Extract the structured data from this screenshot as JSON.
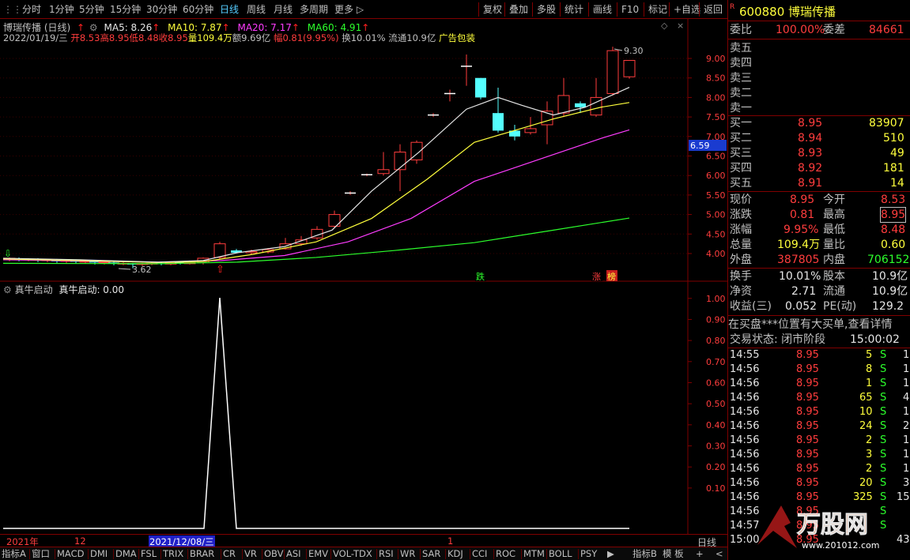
{
  "toolbar": {
    "left_items": [
      "分时",
      "1分钟",
      "5分钟",
      "15分钟",
      "30分钟",
      "60分钟",
      "日线",
      "周线",
      "月线",
      "多周期",
      "更多"
    ],
    "active": "日线",
    "right_items": [
      "复权",
      "叠加",
      "多股",
      "统计",
      "画线",
      "F10",
      "标记",
      "+自选",
      "返回"
    ]
  },
  "chart_header": {
    "title": "博瑞传播 (日线)",
    "ma5": "MA5: 8.26",
    "ma10": "MA10: 7.87",
    "ma20": "MA20: 7.17",
    "ma60": "MA60: 4.91",
    "info_date": "2022/01/19/三",
    "info_open": "开8.53",
    "info_high": "高8.95",
    "info_low": "低8.48",
    "info_close": "收8.95",
    "info_vol": "量109.4万",
    "info_amt": "额9.69亿",
    "info_chg": "幅0.81(9.95%)",
    "info_turn": "换10.01%",
    "info_float": "流通10.9亿",
    "info_tag": "广告包装"
  },
  "price_axis": [
    "9.00",
    "8.50",
    "8.00",
    "7.50",
    "7.00",
    "6.50",
    "6.00",
    "5.50",
    "5.00",
    "4.50",
    "4.00"
  ],
  "price_marker": "6.59",
  "annotations": {
    "high_label": "9.30",
    "low_label": "3.62",
    "tag_die": "跌",
    "tag_zhang": "涨",
    "tag_bang": "榜"
  },
  "indicator_header": {
    "name": "真牛启动",
    "value": "真牛启动: 0.00"
  },
  "indicator_axis": [
    "1.00",
    "0.90",
    "0.80",
    "0.70",
    "0.60",
    "0.50",
    "0.40",
    "0.30",
    "0.20",
    "0.10"
  ],
  "time_axis": {
    "y2021": "2021年",
    "m12": "12",
    "cursor_date": "2021/12/08/三",
    "m1": "1",
    "period": "日线"
  },
  "bottom_tabs": [
    "指标A",
    "窗口",
    "MACD",
    "DMI",
    "DMA",
    "FSL",
    "TRIX",
    "BRAR",
    "CR",
    "VR",
    "OBV",
    "ASI",
    "EMV",
    "VOL-TDX",
    "RSI",
    "WR",
    "SAR",
    "KDJ",
    "CCI",
    "ROC",
    "MTM",
    "BOLL",
    "PSY"
  ],
  "bottom_right": [
    "指标B",
    "模 板",
    "+",
    "<"
  ],
  "quote": {
    "code": "600880",
    "name": "博瑞传播",
    "weibi_label": "委比",
    "weibi_value": "100.00%",
    "weicha_label": "委差",
    "weicha_value": "84661",
    "sells": [
      {
        "label": "卖五",
        "price": "",
        "vol": ""
      },
      {
        "label": "卖四",
        "price": "",
        "vol": ""
      },
      {
        "label": "卖三",
        "price": "",
        "vol": ""
      },
      {
        "label": "卖二",
        "price": "",
        "vol": ""
      },
      {
        "label": "卖一",
        "price": "",
        "vol": ""
      }
    ],
    "buys": [
      {
        "label": "买一",
        "price": "8.95",
        "vol": "83907"
      },
      {
        "label": "买二",
        "price": "8.94",
        "vol": "510"
      },
      {
        "label": "买三",
        "price": "8.93",
        "vol": "49"
      },
      {
        "label": "买四",
        "price": "8.92",
        "vol": "181"
      },
      {
        "label": "买五",
        "price": "8.91",
        "vol": "14"
      }
    ],
    "stats": [
      {
        "l1": "现价",
        "v1": "8.95",
        "l2": "今开",
        "v2": "8.53"
      },
      {
        "l1": "涨跌",
        "v1": "0.81",
        "l2": "最高",
        "v2": "8.95"
      },
      {
        "l1": "涨幅",
        "v1": "9.95%",
        "l2": "最低",
        "v2": "8.48"
      },
      {
        "l1": "总量",
        "v1": "109.4万",
        "l2": "量比",
        "v2": "0.60"
      },
      {
        "l1": "外盘",
        "v1": "387805",
        "l2": "内盘",
        "v2": "706152"
      }
    ],
    "fund": [
      {
        "l1": "换手",
        "v1": "10.01%",
        "l2": "股本",
        "v2": "10.9亿"
      },
      {
        "l1": "净资",
        "v1": "2.71",
        "l2": "流通",
        "v2": "10.9亿"
      },
      {
        "l1": "收益(三)",
        "v1": "0.052",
        "l2": "PE(动)",
        "v2": "129.2"
      }
    ],
    "notice": "在买盘***位置有大买单,查看详情",
    "status_label": "交易状态: 闭市阶段",
    "status_time": "15:00:02",
    "ticks": [
      {
        "t": "14:55",
        "p": "8.95",
        "v": "5",
        "s": "S",
        "n": "1"
      },
      {
        "t": "14:56",
        "p": "8.95",
        "v": "8",
        "s": "S",
        "n": "1"
      },
      {
        "t": "14:56",
        "p": "8.95",
        "v": "1",
        "s": "S",
        "n": "1"
      },
      {
        "t": "14:56",
        "p": "8.95",
        "v": "65",
        "s": "S",
        "n": "4"
      },
      {
        "t": "14:56",
        "p": "8.95",
        "v": "10",
        "s": "S",
        "n": "1"
      },
      {
        "t": "14:56",
        "p": "8.95",
        "v": "24",
        "s": "S",
        "n": "2"
      },
      {
        "t": "14:56",
        "p": "8.95",
        "v": "2",
        "s": "S",
        "n": "1"
      },
      {
        "t": "14:56",
        "p": "8.95",
        "v": "3",
        "s": "S",
        "n": "1"
      },
      {
        "t": "14:56",
        "p": "8.95",
        "v": "2",
        "s": "S",
        "n": "1"
      },
      {
        "t": "14:56",
        "p": "8.95",
        "v": "20",
        "s": "S",
        "n": "3"
      },
      {
        "t": "14:56",
        "p": "8.95",
        "v": "325",
        "s": "S",
        "n": "15"
      },
      {
        "t": "14:56",
        "p": "8.95",
        "v": "",
        "s": "S",
        "n": ""
      },
      {
        "t": "14:57",
        "p": "8.95",
        "v": "",
        "s": "S",
        "n": ""
      },
      {
        "t": "15:00",
        "p": "8.95",
        "v": "",
        "s": "",
        "n": "43"
      }
    ],
    "watermark": "www.201012.com"
  }
}
